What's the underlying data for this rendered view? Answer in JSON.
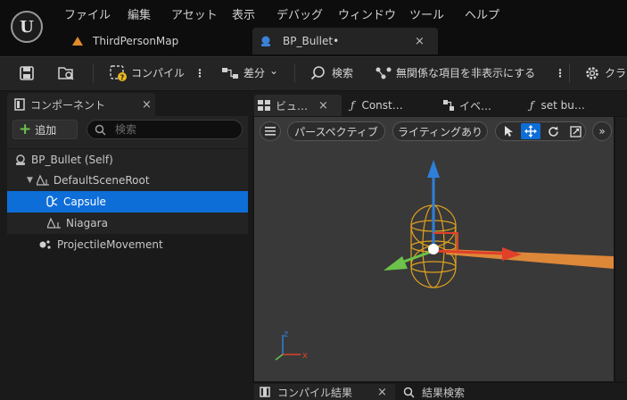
{
  "menu": [
    "ファイル",
    "編集",
    "アセット",
    "表示",
    "デバッグ",
    "ウィンドウ",
    "ツール",
    "ヘルプ"
  ],
  "tabs": {
    "map": "ThirdPersonMap",
    "bullet": "BP_Bullet•",
    "close": "×"
  },
  "toolbar": {
    "compile": "コンパイル",
    "diff": "差分",
    "search": "検索",
    "hide_unrelated": "無関係な項目を非表示にする",
    "class": "クラ",
    "more": "⋮",
    "chevron": "⌄"
  },
  "components": {
    "title": "コンポーネント",
    "close": "×",
    "add": "追加",
    "add_plus": "+",
    "search_placeholder": "検索",
    "items": [
      {
        "label": "BP_Bullet (Self)"
      },
      {
        "label": "DefaultSceneRoot"
      },
      {
        "label": "Capsule",
        "selected": true
      },
      {
        "label": "Niagara"
      },
      {
        "label": "ProjectileMovement"
      }
    ]
  },
  "viewport_tabs": [
    {
      "label": "ビュ…",
      "icon": "grid-icon"
    },
    {
      "label": "Const…",
      "icon": "function-icon"
    },
    {
      "label": "イベ…",
      "icon": "graph-icon"
    },
    {
      "label": "set bu…",
      "icon": "function-icon"
    }
  ],
  "viewport": {
    "perspective": "パースペクティブ",
    "lighting": "ライティングあり",
    "axis_z": "z",
    "axis_x": "x",
    "overflow": "»"
  },
  "bottom": {
    "compile_results": "コンパイル結果",
    "results_search": "結果検索",
    "close": "×"
  },
  "colors": {
    "selected": "#0e6ed8",
    "accent_blue": "#2f7fd8",
    "add_green": "#6cc24a",
    "bullet_tab_icon": "#3a82d8",
    "map_tab_icon": "#e08a2a",
    "capsule_wire": "#e0a020",
    "projectile_beam": "#f0903a"
  }
}
